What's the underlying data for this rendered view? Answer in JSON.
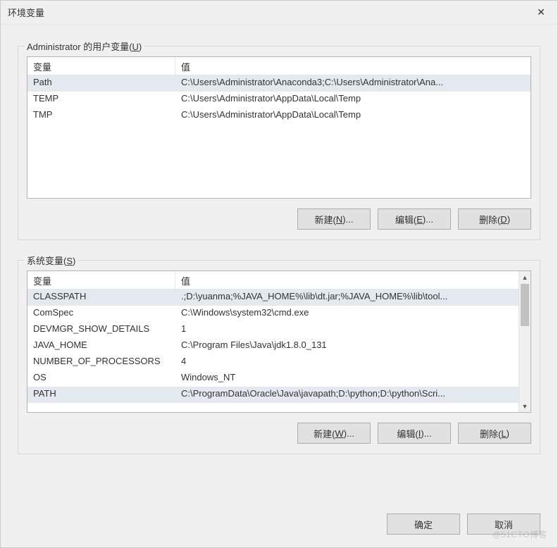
{
  "window": {
    "title": "环境变量",
    "close_glyph": "✕"
  },
  "user_section": {
    "legend_text": "Administrator 的用户变量(",
    "legend_accel": "U",
    "legend_close": ")",
    "headers": {
      "variable": "变量",
      "value": "值"
    },
    "rows": [
      {
        "variable": "Path",
        "value": "C:\\Users\\Administrator\\Anaconda3;C:\\Users\\Administrator\\Ana...",
        "selected": true
      },
      {
        "variable": "TEMP",
        "value": "C:\\Users\\Administrator\\AppData\\Local\\Temp",
        "selected": false
      },
      {
        "variable": "TMP",
        "value": "C:\\Users\\Administrator\\AppData\\Local\\Temp",
        "selected": false
      }
    ],
    "buttons": {
      "new": {
        "prefix": "新建(",
        "accel": "N",
        "suffix": ")..."
      },
      "edit": {
        "prefix": "编辑(",
        "accel": "E",
        "suffix": ")..."
      },
      "delete": {
        "prefix": "删除(",
        "accel": "D",
        "suffix": ")"
      }
    }
  },
  "system_section": {
    "legend_text": "系统变量(",
    "legend_accel": "S",
    "legend_close": ")",
    "headers": {
      "variable": "变量",
      "value": "值"
    },
    "rows": [
      {
        "variable": "CLASSPATH",
        "value": ".;D:\\yuanma;%JAVA_HOME%\\lib\\dt.jar;%JAVA_HOME%\\lib\\tool...",
        "selected": true
      },
      {
        "variable": "ComSpec",
        "value": "C:\\Windows\\system32\\cmd.exe",
        "selected": false
      },
      {
        "variable": "DEVMGR_SHOW_DETAILS",
        "value": "1",
        "selected": false
      },
      {
        "variable": "JAVA_HOME",
        "value": "C:\\Program Files\\Java\\jdk1.8.0_131",
        "selected": false
      },
      {
        "variable": "NUMBER_OF_PROCESSORS",
        "value": "4",
        "selected": false
      },
      {
        "variable": "OS",
        "value": "Windows_NT",
        "selected": false
      },
      {
        "variable": "PATH",
        "value": "C:\\ProgramData\\Oracle\\Java\\javapath;D:\\python;D:\\python\\Scri...",
        "selected": true
      }
    ],
    "buttons": {
      "new": {
        "prefix": "新建(",
        "accel": "W",
        "suffix": ")..."
      },
      "edit": {
        "prefix": "编辑(",
        "accel": "I",
        "suffix": ")..."
      },
      "delete": {
        "prefix": "删除(",
        "accel": "L",
        "suffix": ")"
      }
    }
  },
  "dialog_buttons": {
    "ok": "确定",
    "cancel": "取消"
  },
  "watermark": "@51CTO博客"
}
